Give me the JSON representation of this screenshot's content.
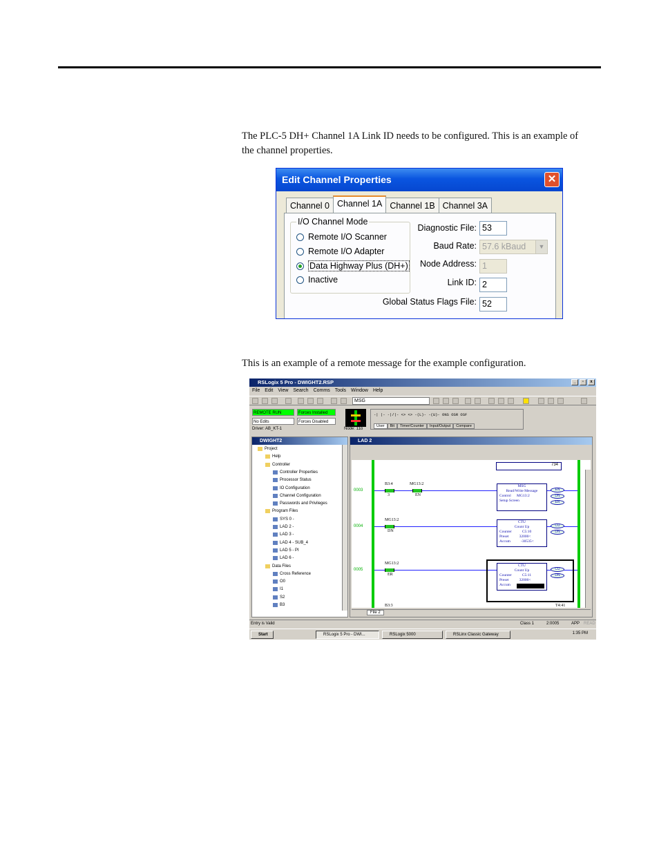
{
  "paragraphs": {
    "p1": "The PLC-5 DH+ Channel 1A Link ID needs to be configured. This is an example of the channel properties.",
    "p2": "This is an example of a remote message for the example configuration."
  },
  "dialog": {
    "title": "Edit Channel Properties",
    "close_icon": "close-icon",
    "tabs": [
      "Channel 0",
      "Channel 1A",
      "Channel 1B",
      "Channel 3A"
    ],
    "active_tab": "Channel 1A",
    "group_label": "I/O Channel Mode",
    "radios": [
      {
        "label": "Remote I/O Scanner",
        "checked": false
      },
      {
        "label": "Remote I/O Adapter",
        "checked": false
      },
      {
        "label": "Data Highway Plus (DH+)",
        "checked": true
      },
      {
        "label": "Inactive",
        "checked": false
      }
    ],
    "fields": {
      "diagnostic_file": {
        "label": "Diagnostic File:",
        "value": "53"
      },
      "baud_rate": {
        "label": "Baud Rate:",
        "value": "57.6 kBaud"
      },
      "node_address": {
        "label": "Node Address:",
        "value": "1"
      },
      "link_id": {
        "label": "Link ID:",
        "value": "2"
      },
      "global_status": {
        "label": "Global Status Flags File:",
        "value": "52"
      }
    }
  },
  "rslogix": {
    "title": "RSLogix 5 Pro - DWIGHT2.RSP",
    "menu": [
      "File",
      "Edit",
      "View",
      "Search",
      "Comms",
      "Tools",
      "Window",
      "Help"
    ],
    "msg_box": "MSG",
    "mode": "REMOTE RUN",
    "edits": "No Edits",
    "forces_installed": "Forces Installed",
    "forces_disabled": "Forces Disabled",
    "driver": "Driver: AB_KT-1",
    "node": "Node: 11o",
    "instr_palette": "-| |- -|/|- <> <> -(L)- -(U)- ONS OSR OSF",
    "palette_tabs": [
      "User",
      "Bit",
      "Timer/Counter",
      "Input/Output",
      "Compare"
    ],
    "project_window": "DWIGHT2",
    "tree": [
      "Project",
      "Help",
      "Controller",
      "Controller Properties",
      "Processor Status",
      "IO Configuration",
      "Channel Configuration",
      "Passwords and Privileges",
      "Program Files",
      "SYS 0 -",
      "LAD 2 -",
      "LAD 3 -",
      "LAD 4 - SUB_4",
      "LAD 5 - PI",
      "LAD 6 -",
      "Data Files",
      "Cross Reference",
      "O0",
      "I1",
      "S2",
      "B3"
    ],
    "ladder_window": "LAD 2",
    "top_value": "734",
    "rungs": [
      {
        "num": "0003",
        "c1": "B3:4",
        "c1sub": "3",
        "c2": "MG13:2",
        "c2sub": "EN",
        "box": [
          "MSG",
          "Read/Write Message",
          "Control      MG13:2",
          "Setup Screen"
        ],
        "coils": [
          "EN",
          "DN",
          "ER"
        ]
      },
      {
        "num": "0004",
        "c1": "MG13:2",
        "c1sub": "DN",
        "box": [
          "CTU",
          "Count Up",
          "Counter           C5:10",
          "Preset           32000<",
          "Accum           -30535<"
        ],
        "coils": [
          "CU",
          "DN"
        ]
      },
      {
        "num": "0005",
        "c1": "MG13:2",
        "c1sub": "ER",
        "box": [
          "CTU",
          "Count Up",
          "Counter           C5:11",
          "Preset           32000<",
          "Accum"
        ],
        "coils": [
          "CU",
          "DN"
        ]
      }
    ],
    "bottom_label": "B3:3",
    "bottom_timer": "T4:41",
    "file_tab": "File 2",
    "status_msg": "Entry is Valid",
    "status_cells": [
      "Class 1",
      "2:0005",
      "APP",
      "READ"
    ],
    "taskbar": [
      "Start",
      "RSLogix 5 Pro - DWI...",
      "RSLogix 5000",
      "RSLinx Classic Gateway"
    ],
    "clock": "1:35 PM"
  }
}
